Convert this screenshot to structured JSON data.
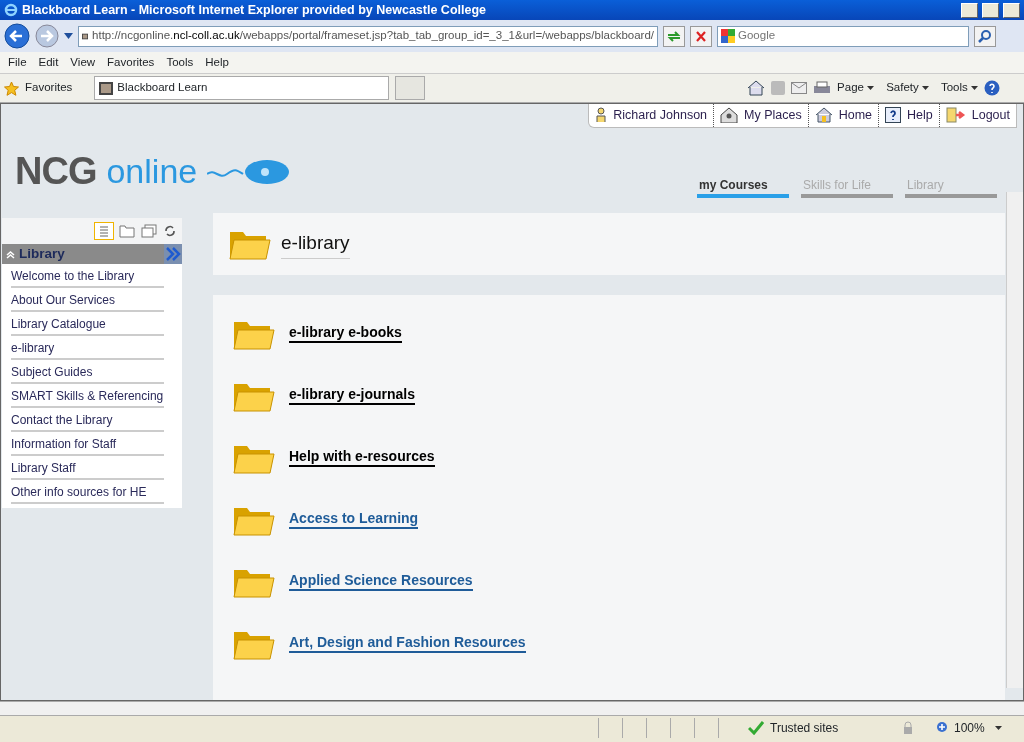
{
  "window": {
    "title": "Blackboard Learn - Microsoft Internet Explorer provided by Newcastle College"
  },
  "address_bar": {
    "url_prefix": "http://ncgonline.",
    "url_domain": "ncl-coll.ac.uk",
    "url_rest": "/webapps/portal/frameset.jsp?tab_tab_group_id=_3_1&url=/webapps/blackboard/"
  },
  "search": {
    "placeholder": "Google"
  },
  "menu": [
    "File",
    "Edit",
    "View",
    "Favorites",
    "Tools",
    "Help"
  ],
  "favorites_bar": {
    "label": "Favorites",
    "tab": "Blackboard Learn",
    "commands": [
      "Page",
      "Safety",
      "Tools"
    ]
  },
  "logo": {
    "brand": "NCG",
    "product": "online"
  },
  "user_links": [
    {
      "kind": "user",
      "label": "Richard Johnson"
    },
    {
      "kind": "places",
      "label": "My Places"
    },
    {
      "kind": "home",
      "label": "Home"
    },
    {
      "kind": "help",
      "label": "Help"
    },
    {
      "kind": "logout",
      "label": "Logout"
    }
  ],
  "tabs": [
    {
      "label": "my Courses",
      "selected": true
    },
    {
      "label": "Skills for Life",
      "selected": false
    },
    {
      "label": "Library",
      "selected": false
    }
  ],
  "sidebar": {
    "title": "Library",
    "items": [
      "Welcome to the Library",
      "About Our Services",
      "Library Catalogue",
      "e-library",
      "Subject Guides",
      "SMART Skills & Referencing",
      "Contact the Library",
      "Information for Staff",
      "Library Staff",
      "Other info sources for HE"
    ]
  },
  "page_title": "e-library",
  "folders": [
    {
      "label": "e-library e-books",
      "color": "#000000"
    },
    {
      "label": "e-library e-journals",
      "color": "#000000"
    },
    {
      "label": "Help with e-resources",
      "color": "#000000"
    },
    {
      "label": "Access to Learning",
      "color": "#1f5c99"
    },
    {
      "label": "Applied Science Resources",
      "color": "#1f5c99"
    },
    {
      "label": "Art, Design and Fashion Resources",
      "color": "#1f5c99"
    }
  ],
  "status_bar": {
    "zone": "Trusted sites",
    "zoom": "100%"
  }
}
